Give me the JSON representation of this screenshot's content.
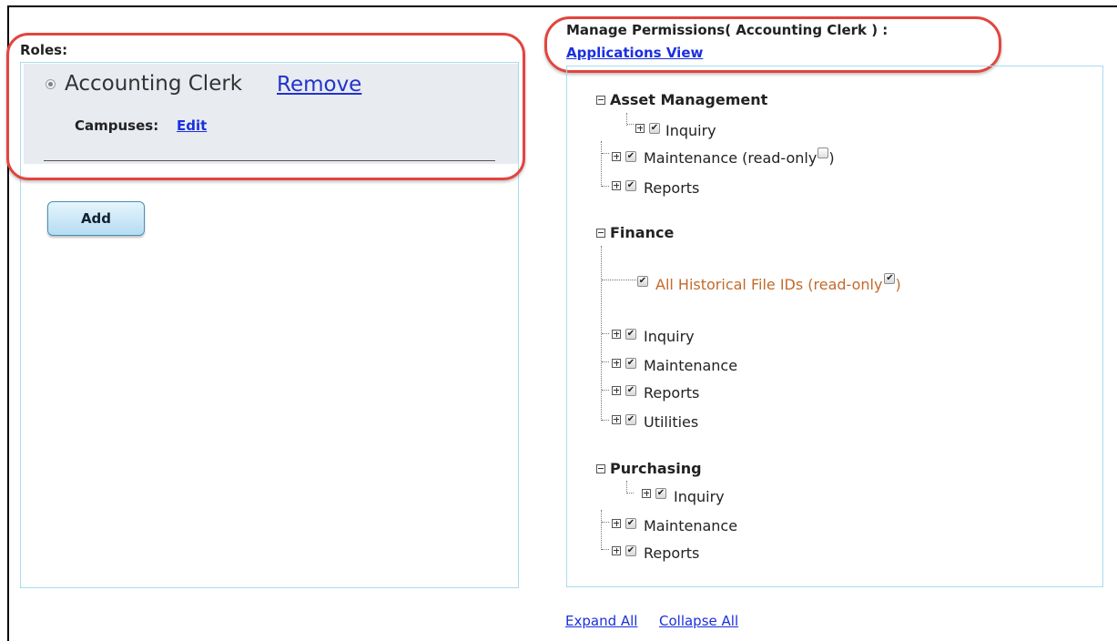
{
  "roles": {
    "label": "Roles:",
    "role_name": "Accounting Clerk",
    "remove_label": "Remove",
    "campuses_label": "Campuses:",
    "edit_label": "Edit",
    "add_label": "Add"
  },
  "permissions": {
    "title": "Manage Permissions( Accounting Clerk ) :",
    "view_link": "Applications View",
    "categories": [
      {
        "name": "Asset Management",
        "items": [
          "Inquiry",
          "Maintenance (read-only",
          ")",
          "Reports"
        ]
      },
      {
        "name": "Finance",
        "special": "All Historical File IDs (read-only",
        "special_close": ")",
        "items": [
          "Inquiry",
          "Maintenance",
          "Reports",
          "Utilities"
        ]
      },
      {
        "name": "Purchasing",
        "items": [
          "Inquiry",
          "Maintenance",
          "Reports"
        ]
      }
    ]
  },
  "footer": {
    "expand_all": "Expand All",
    "collapse_all": "Collapse All"
  },
  "colors": {
    "highlight_oval": "#e2453f",
    "link": "#1a2fe0",
    "panel_border": "#a9dcef",
    "special_item": "#c26a2a"
  }
}
